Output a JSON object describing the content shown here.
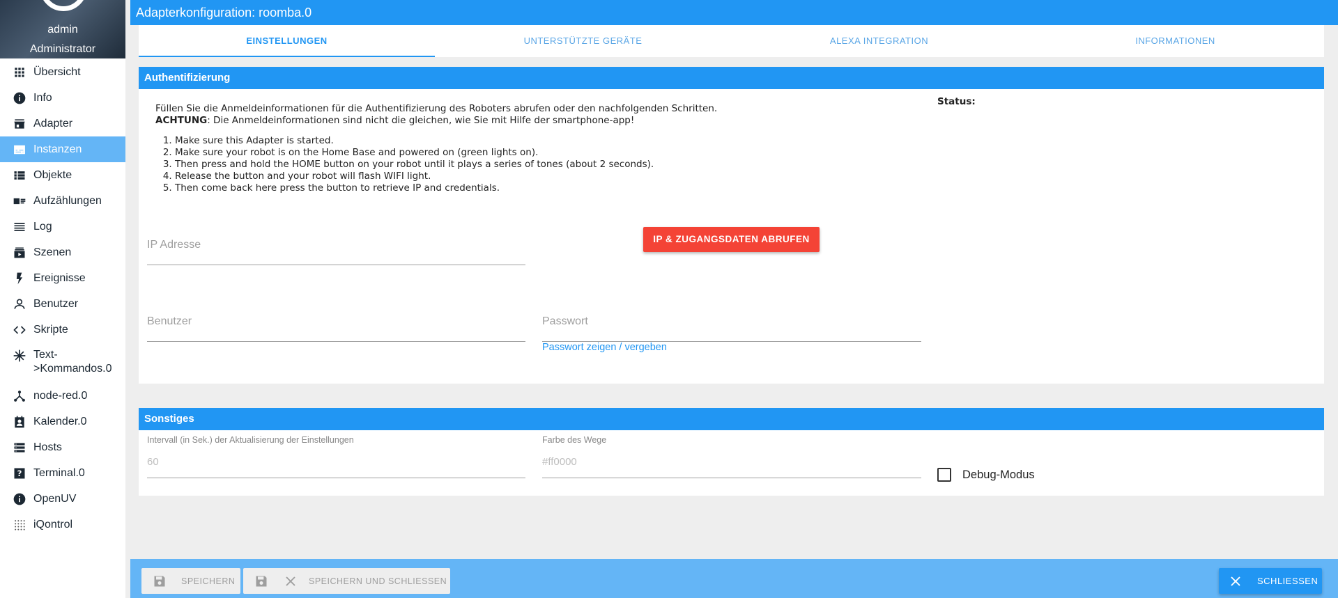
{
  "sidebar": {
    "user": {
      "name": "admin",
      "role": "Administrator"
    },
    "items": [
      {
        "label": "Übersicht",
        "icon": "apps-grid-icon"
      },
      {
        "label": "Info",
        "icon": "info-icon"
      },
      {
        "label": "Adapter",
        "icon": "store-icon"
      },
      {
        "label": "Instanzen",
        "icon": "subtitles-icon",
        "active": true
      },
      {
        "label": "Objekte",
        "icon": "list-icon"
      },
      {
        "label": "Aufzählungen",
        "icon": "contact-card-icon"
      },
      {
        "label": "Log",
        "icon": "lines-icon"
      },
      {
        "label": "Szenen",
        "icon": "subscriptions-icon"
      },
      {
        "label": "Ereignisse",
        "icon": "flash-icon"
      },
      {
        "label": "Benutzer",
        "icon": "person-icon"
      },
      {
        "label": "Skripte",
        "icon": "code-icon"
      },
      {
        "label": "Text->Kommandos.0",
        "label_line1": "Text-",
        "label_line2": ">Kommandos.0",
        "icon": "snowflake-icon"
      },
      {
        "label": "node-red.0",
        "icon": "nodes-icon"
      },
      {
        "label": "Kalender.0",
        "icon": "calendar-person-icon"
      },
      {
        "label": "Hosts",
        "icon": "storage-icon"
      },
      {
        "label": "Terminal.0",
        "icon": "help-box-icon"
      },
      {
        "label": "OpenUV",
        "icon": "info-icon"
      },
      {
        "label": "iQontrol",
        "icon": "dots-grid-icon"
      }
    ]
  },
  "title": "Adapterkonfiguration: roomba.0",
  "tabs": [
    "EINSTELLUNGEN",
    "UNTERSTÜTZTE GERÄTE",
    "ALEXA INTEGRATION",
    "INFORMATIONEN"
  ],
  "auth": {
    "header": "Authentifizierung",
    "intro_line1": "Füllen Sie die Anmeldeinformationen für die Authentifizierung des Roboters abrufen oder den nachfolgenden Schritten.",
    "warning_bold": "ACHTUNG",
    "warning_text": ": Die Anmeldeinformationen sind nicht die gleichen, wie Sie mit Hilfe der smartphone-app!",
    "steps": [
      "Make sure this Adapter is started.",
      "Make sure your robot is on the Home Base and powered on (green lights on).",
      "Then press and hold the HOME button on your robot until it plays a series of tones (about 2 seconds).",
      "Release the button and your robot will flash WIFI light.",
      "Then come back here press the button to retrieve IP and credentials."
    ],
    "status_label": "Status:",
    "ip_placeholder": "IP Adresse",
    "fetch_button": "IP & ZUGANGSDATEN ABRUFEN",
    "user_placeholder": "Benutzer",
    "password_placeholder": "Passwort",
    "password_link": "Passwort zeigen / vergeben"
  },
  "misc": {
    "header": "Sonstiges",
    "interval_label": "Intervall (in Sek.) der Aktualisierung der Einstellungen",
    "interval_value": "60",
    "color_label": "Farbe des Wege",
    "color_value": "#ff0000",
    "debug_label": "Debug-Modus"
  },
  "footer": {
    "save": "SPEICHERN",
    "save_close": "SPEICHERN UND SCHLIESSEN",
    "close": "SCHLIESSEN"
  },
  "colors": {
    "primary": "#2196f3",
    "sidebar_active": "#64b5f6",
    "danger": "#f44336"
  }
}
